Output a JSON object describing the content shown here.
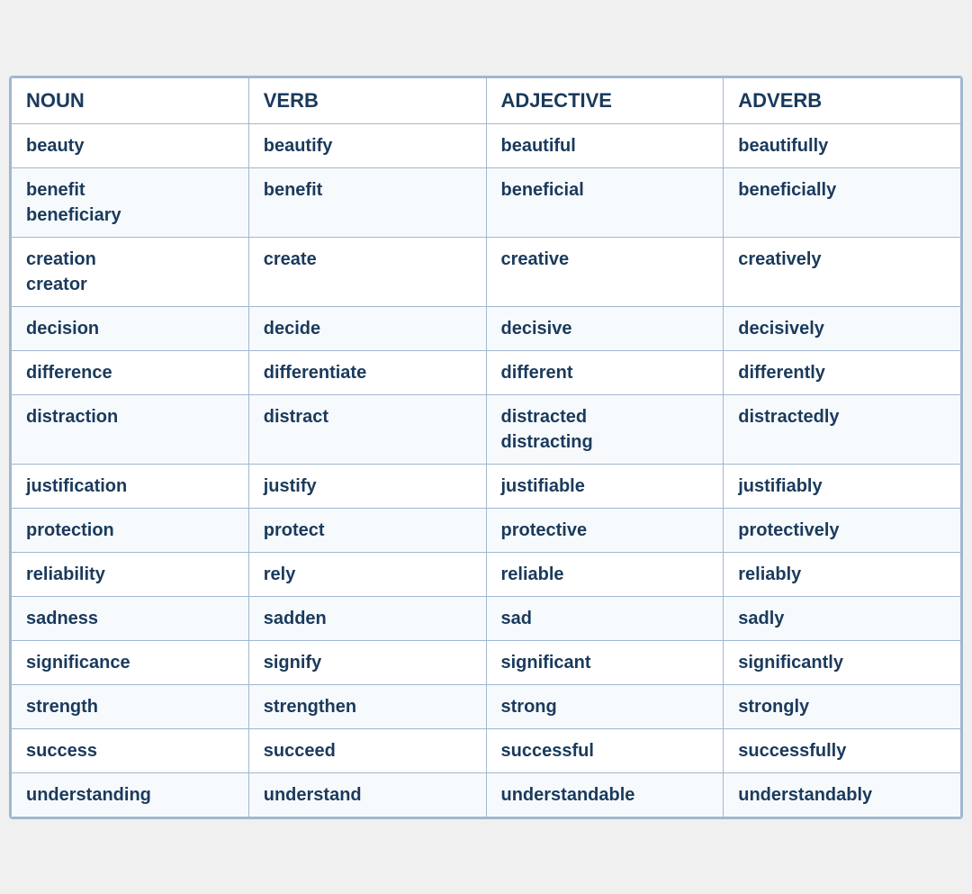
{
  "table": {
    "headers": [
      "NOUN",
      "VERB",
      "ADJECTIVE",
      "ADVERB"
    ],
    "rows": [
      [
        "beauty",
        "beautify",
        "beautiful",
        "beautifully"
      ],
      [
        "benefit\nbeneficiary",
        "benefit",
        "beneficial",
        "beneficially"
      ],
      [
        "creation\ncreator",
        "create",
        "creative",
        "creatively"
      ],
      [
        "decision",
        "decide",
        "decisive",
        "decisively"
      ],
      [
        "difference",
        "differentiate",
        "different",
        "differently"
      ],
      [
        "distraction",
        "distract",
        "distracted\ndistracting",
        "distractedly"
      ],
      [
        "justification",
        "justify",
        "justifiable",
        "justifiably"
      ],
      [
        "protection",
        "protect",
        "protective",
        "protectively"
      ],
      [
        "reliability",
        "rely",
        "reliable",
        "reliably"
      ],
      [
        "sadness",
        "sadden",
        "sad",
        "sadly"
      ],
      [
        "significance",
        "signify",
        "significant",
        "significantly"
      ],
      [
        "strength",
        "strengthen",
        "strong",
        "strongly"
      ],
      [
        "success",
        "succeed",
        "successful",
        "successfully"
      ],
      [
        "understanding",
        "understand",
        "understandable",
        "understandably"
      ]
    ]
  }
}
